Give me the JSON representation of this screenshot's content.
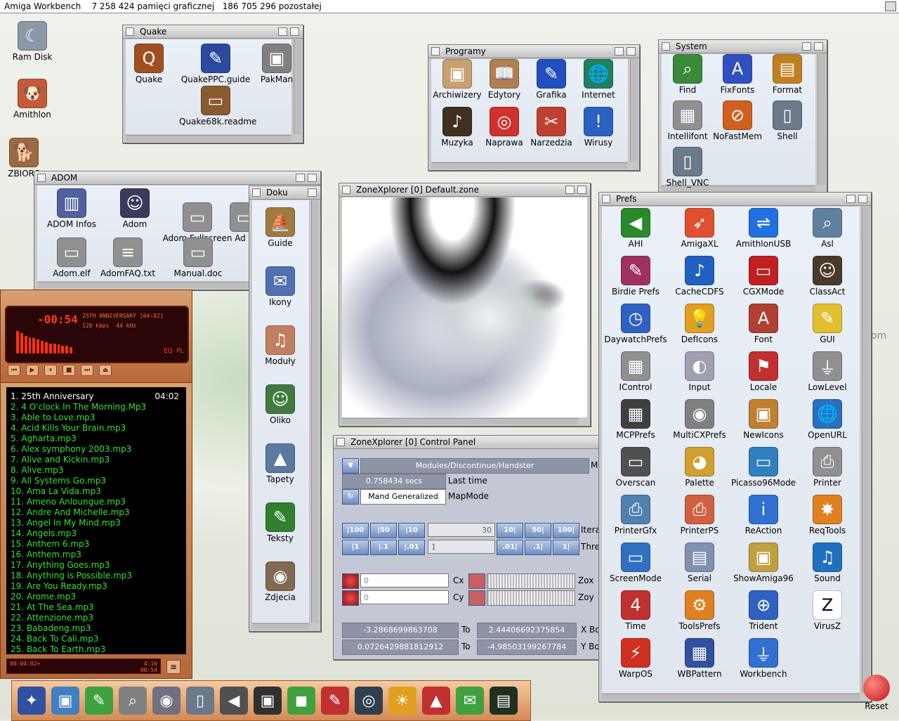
{
  "screen_title": {
    "title": "Amiga Workbench",
    "graphics_memory": "7 258 424 pamięci graficznej",
    "remaining": "186 705 296 pozostałej"
  },
  "desktop_icons": [
    {
      "label": "Ram Disk",
      "icon": "ram-disk-icon",
      "color": "#8a98a8",
      "glyph": "☾"
    },
    {
      "label": "Amithlon",
      "icon": "amithlon-dog-icon",
      "color": "#c35a3a",
      "glyph": "🐶"
    },
    {
      "label": "ZBIORC",
      "icon": "dog-drive-icon",
      "color": "#9a6a40",
      "glyph": "🐕"
    }
  ],
  "windows": {
    "quake": {
      "title": "Quake",
      "icons": [
        {
          "label": "Quake",
          "icon": "quake-icon",
          "color": "#a05020",
          "glyph": "Q"
        },
        {
          "label": "QuakePPC.guide",
          "icon": "guide-icon",
          "color": "#2a4aa0",
          "glyph": "✎"
        },
        {
          "label": "PakMan",
          "icon": "pakman-icon",
          "color": "#808080",
          "glyph": "▣"
        },
        {
          "label": "Quake68k.readme",
          "icon": "readme-icon",
          "color": "#8a5a30",
          "glyph": "▭"
        }
      ]
    },
    "programy": {
      "title": "Programy",
      "icons": [
        {
          "label": "Archiwizery",
          "icon": "archive-box-icon",
          "color": "#c9a070",
          "glyph": "▣"
        },
        {
          "label": "Edytory",
          "icon": "book-icon",
          "color": "#b08050",
          "glyph": "📖"
        },
        {
          "label": "Grafika",
          "icon": "paint-brush-icon",
          "color": "#2050c0",
          "glyph": "✎"
        },
        {
          "label": "Internet",
          "icon": "globe-icon",
          "color": "#208060",
          "glyph": "🌐"
        },
        {
          "label": "Muzyka",
          "icon": "speaker-icon",
          "color": "#403020",
          "glyph": "♪"
        },
        {
          "label": "Naprawa",
          "icon": "lifebuoy-icon",
          "color": "#d03030",
          "glyph": "◎"
        },
        {
          "label": "Narzedzia",
          "icon": "tools-icon",
          "color": "#c04030",
          "glyph": "✂"
        },
        {
          "label": "Wirusy",
          "icon": "folder-warning-icon",
          "color": "#2a60c0",
          "glyph": "!"
        }
      ]
    },
    "system": {
      "title": "System",
      "icons": [
        {
          "label": "Find",
          "icon": "find-icon",
          "color": "#3a8a3a",
          "glyph": "⌕"
        },
        {
          "label": "FixFonts",
          "icon": "fixfonts-icon",
          "color": "#3050c0",
          "glyph": "A"
        },
        {
          "label": "Format",
          "icon": "format-disk-icon",
          "color": "#c08020",
          "glyph": "▤"
        },
        {
          "label": "Intellifont",
          "icon": "intellifont-icon",
          "color": "#909090",
          "glyph": "▦"
        },
        {
          "label": "NoFastMem",
          "icon": "nofastmem-icon",
          "color": "#d06020",
          "glyph": "⊘"
        },
        {
          "label": "Shell",
          "icon": "shell-icon",
          "color": "#6a7a8a",
          "glyph": "▯"
        },
        {
          "label": "Shell_VNC",
          "icon": "shell-vnc-icon",
          "color": "#6a7a8a",
          "glyph": "▯"
        }
      ]
    },
    "adom": {
      "title": "ADOM",
      "icons": [
        {
          "label": "ADOM Infos",
          "icon": "adom-infos-icon",
          "color": "#5060a0",
          "glyph": "▥"
        },
        {
          "label": "Adom",
          "icon": "adom-face-icon",
          "color": "#3a3a5a",
          "glyph": "☺"
        },
        {
          "label": "Adom Fullscreen",
          "icon": "fullscreen-icon",
          "color": "#909090",
          "glyph": "▭"
        },
        {
          "label": "Ad",
          "icon": "partial-icon",
          "color": "#909090",
          "glyph": "▭"
        },
        {
          "label": "Adom.elf",
          "icon": "elf-file-icon",
          "color": "#909090",
          "glyph": "▭"
        },
        {
          "label": "AdomFAQ.txt",
          "icon": "text-file-icon",
          "color": "#909090",
          "glyph": "≡"
        },
        {
          "label": "Manual.doc",
          "icon": "doc-file-icon",
          "color": "#909090",
          "glyph": "▭"
        }
      ]
    },
    "doku": {
      "title": "Doku",
      "icons": [
        {
          "label": "Guide",
          "icon": "ship-icon",
          "color": "#a07a40",
          "glyph": "⛵"
        },
        {
          "label": "Ikony",
          "icon": "stamp-icon",
          "color": "#5070b0",
          "glyph": "✉"
        },
        {
          "label": "Moduły",
          "icon": "bear-music-icon",
          "color": "#c08060",
          "glyph": "♫"
        },
        {
          "label": "Oliko",
          "icon": "portrait-icon",
          "color": "#407a40",
          "glyph": "☺"
        },
        {
          "label": "Tapety",
          "icon": "mountain-icon",
          "color": "#5a7aa0",
          "glyph": "▲"
        },
        {
          "label": "Teksty",
          "icon": "pen-icon",
          "color": "#308030",
          "glyph": "✎"
        },
        {
          "label": "Zdjecia",
          "icon": "photo-icon",
          "color": "#806a50",
          "glyph": "◉"
        }
      ]
    },
    "zone_view": {
      "title": "ZoneXplorer [0] Default.zone"
    },
    "control_panel": {
      "title": "ZoneXplorer [0] Control Panel",
      "module": "Modules/Discontinue/Handster",
      "module_suffix": "M",
      "last_time_value": "0.758434 secs",
      "last_time_label": "Last time",
      "mapmode_value": "Mand Generalized",
      "mapmode_label": "MapMode",
      "iter_buttons_left": [
        "|100",
        "|50",
        "|10"
      ],
      "iter_buttons_right": [
        "10|",
        "50|",
        "100|"
      ],
      "iter_value": "30",
      "iter_label": "Itera",
      "thre_buttons_left": [
        "|1",
        "|.1",
        "|.01"
      ],
      "thre_buttons_right": [
        ".01|",
        ".1|",
        "1|"
      ],
      "thre_value": "1",
      "thre_label": "Thre",
      "cx_value": "0",
      "cx_label": "Cx",
      "zox_label": "Zox",
      "cy_value": "0",
      "cy_label": "Cy",
      "zoy_label": "Zoy",
      "xb_from": "-3.2868699863708",
      "xb_to": "2.44406692375854",
      "to_label": "To",
      "xb_label": "X Bo",
      "yb_from": "0.0726429881812912",
      "yb_to": "-4.98503199267784",
      "yb_label": "Y Bo"
    },
    "prefs": {
      "title": "Prefs",
      "icons": [
        {
          "label": "AHI",
          "icon": "speaker-ahi-icon",
          "color": "#2a8a2a",
          "glyph": "◀"
        },
        {
          "label": "AmigaXL",
          "icon": "rocket-icon",
          "color": "#e05030",
          "glyph": "➶"
        },
        {
          "label": "AmithlonUSB",
          "icon": "usb-icon",
          "color": "#2070e0",
          "glyph": "⇌"
        },
        {
          "label": "Asl",
          "icon": "magnifier-icon",
          "color": "#6080a0",
          "glyph": "⌕"
        },
        {
          "label": "Birdie Prefs",
          "icon": "brush-icon",
          "color": "#a03060",
          "glyph": "✎"
        },
        {
          "label": "CacheCDFS",
          "icon": "cd-music-icon",
          "color": "#2060c0",
          "glyph": "♪"
        },
        {
          "label": "CGXMode",
          "icon": "monitor-icon",
          "color": "#c02020",
          "glyph": "▭"
        },
        {
          "label": "ClassAct",
          "icon": "face-icon",
          "color": "#4a3a2a",
          "glyph": "☺"
        },
        {
          "label": "DaywatchPrefs",
          "icon": "clock-icon",
          "color": "#3060c0",
          "glyph": "◷"
        },
        {
          "label": "DefIcons",
          "icon": "lightbulb-icon",
          "color": "#e0a020",
          "glyph": "💡"
        },
        {
          "label": "Font",
          "icon": "font-icon",
          "color": "#b04030",
          "glyph": "A"
        },
        {
          "label": "GUI",
          "icon": "gui-brush-icon",
          "color": "#e0c030",
          "glyph": "✎"
        },
        {
          "label": "IControl",
          "icon": "cubes-icon",
          "color": "#909090",
          "glyph": "▦"
        },
        {
          "label": "Input",
          "icon": "mouse-icon",
          "color": "#a0a0b0",
          "glyph": "◐"
        },
        {
          "label": "Locale",
          "icon": "flags-icon",
          "color": "#c03030",
          "glyph": "⚑"
        },
        {
          "label": "LowLevel",
          "icon": "joystick-icon",
          "color": "#909090",
          "glyph": "⏚"
        },
        {
          "label": "MCPPrefs",
          "icon": "chip-icon",
          "color": "#404040",
          "glyph": "▦"
        },
        {
          "label": "MultiCXPrefs",
          "icon": "camera-icon",
          "color": "#808080",
          "glyph": "◉"
        },
        {
          "label": "NewIcons",
          "icon": "newicons-icon",
          "color": "#c08030",
          "glyph": "▣"
        },
        {
          "label": "OpenURL",
          "icon": "openurl-globe-icon",
          "color": "#2a70c0",
          "glyph": "🌐"
        },
        {
          "label": "Overscan",
          "icon": "overscan-monitor-icon",
          "color": "#505050",
          "glyph": "▭"
        },
        {
          "label": "Palette",
          "icon": "palette-icon",
          "color": "#d0a030",
          "glyph": "◕"
        },
        {
          "label": "Picasso96Mode",
          "icon": "picasso-monitor-icon",
          "color": "#3080c0",
          "glyph": "▭"
        },
        {
          "label": "Printer",
          "icon": "printer-icon",
          "color": "#909090",
          "glyph": "⎙"
        },
        {
          "label": "PrinterGfx",
          "icon": "printer-gfx-icon",
          "color": "#5080b0",
          "glyph": "⎙"
        },
        {
          "label": "PrinterPS",
          "icon": "printer-ps-icon",
          "color": "#d06040",
          "glyph": "⎙"
        },
        {
          "label": "ReAction",
          "icon": "reaction-info-icon",
          "color": "#3070d0",
          "glyph": "i"
        },
        {
          "label": "ReqTools",
          "icon": "reqtools-star-icon",
          "color": "#e08020",
          "glyph": "✸"
        },
        {
          "label": "ScreenMode",
          "icon": "screenmode-monitor-icon",
          "color": "#3070c0",
          "glyph": "▭"
        },
        {
          "label": "Serial",
          "icon": "serial-icon",
          "color": "#8090b0",
          "glyph": "▤"
        },
        {
          "label": "ShowAmiga96",
          "icon": "showamiga-icon",
          "color": "#c0a040",
          "glyph": "▣"
        },
        {
          "label": "Sound",
          "icon": "music-note-icon",
          "color": "#2070c0",
          "glyph": "♫"
        },
        {
          "label": "Time",
          "icon": "calendar-icon",
          "color": "#c03030",
          "glyph": "4"
        },
        {
          "label": "ToolsPrefs",
          "icon": "gear-icon",
          "color": "#e08020",
          "glyph": "⚙"
        },
        {
          "label": "Trident",
          "icon": "trident-icon",
          "color": "#3060c0",
          "glyph": "⊕"
        },
        {
          "label": "VirusZ",
          "icon": "virusz-icon",
          "color": "#ffffff",
          "glyph": "Z"
        },
        {
          "label": "WarpOS",
          "icon": "warpos-icon",
          "color": "#d03020",
          "glyph": "⚡"
        },
        {
          "label": "WBPattern",
          "icon": "wbpattern-icon",
          "color": "#3050a0",
          "glyph": "▦"
        },
        {
          "label": "Workbench",
          "icon": "workbench-joystick-icon",
          "color": "#3070d0",
          "glyph": "⏚"
        }
      ]
    }
  },
  "player": {
    "time": "-00:54",
    "track": "25TH ANNIVERSARY [04:02]",
    "bitrate": "128 kbps",
    "freq": "44 kHz",
    "eq": "EQ",
    "pl": "PL",
    "bar_levels": [
      0.9,
      0.8,
      0.7,
      0.65,
      0.6,
      0.55,
      0.5,
      0.45,
      0.4,
      0.4,
      0.35,
      0.3,
      0.3,
      0.25
    ]
  },
  "playlist": {
    "items": [
      {
        "label": "1. 25th Anniversary",
        "dur": "04:02"
      },
      {
        "label": "2. 4 O'clock In The Morning.Mp3"
      },
      {
        "label": "3. Able to Love.mp3"
      },
      {
        "label": "4. Acid Kills Your Brain.mp3"
      },
      {
        "label": "5. Agharta.mp3"
      },
      {
        "label": "6. Alex symphony 2003.mp3"
      },
      {
        "label": "7. Alive and Kickin.mp3"
      },
      {
        "label": "8. Alive.mp3"
      },
      {
        "label": "9. All Systems Go.mp3"
      },
      {
        "label": "10. Ama La Vida.mp3"
      },
      {
        "label": "11. Ameno Anloungue.mp3"
      },
      {
        "label": "12. Andre And Michelle.mp3"
      },
      {
        "label": "13. Angel In My Mind.mp3"
      },
      {
        "label": "14. Angels.mp3"
      },
      {
        "label": "15. Anthem 6.mp3"
      },
      {
        "label": "16. Anthem.mp3"
      },
      {
        "label": "17. Anything Goes.mp3"
      },
      {
        "label": "18. Anything is Possible.mp3"
      },
      {
        "label": "19. Are You Ready.mp3"
      },
      {
        "label": "20. Arome.mp3"
      },
      {
        "label": "21. At The Sea.mp3"
      },
      {
        "label": "22. Attenzione.mp3"
      },
      {
        "label": "23. Babadeng.mp3"
      },
      {
        "label": "24. Back To Cali.mp3"
      },
      {
        "label": "25. Back To Earth.mp3"
      }
    ],
    "footer_time": "00:04:02+",
    "footer_total": "4:16",
    "footer_pos": "00:54"
  },
  "taskbar": [
    {
      "icon": "rocket-dock-icon",
      "color": "#3050a0",
      "glyph": "✦"
    },
    {
      "icon": "windows-icon",
      "color": "#4080c0",
      "glyph": "▣"
    },
    {
      "icon": "notes-icon",
      "color": "#40a040",
      "glyph": "✎"
    },
    {
      "icon": "search-icon",
      "color": "#808080",
      "glyph": "⌕"
    },
    {
      "icon": "eye-icon",
      "color": "#707080",
      "glyph": "◉"
    },
    {
      "icon": "shell-task-icon",
      "color": "#6a7a8a",
      "glyph": "▯"
    },
    {
      "icon": "speaker-task-icon",
      "color": "#505050",
      "glyph": "◀"
    },
    {
      "icon": "floppy-icon",
      "color": "#303030",
      "glyph": "▣"
    },
    {
      "icon": "cube-icon",
      "color": "#40a040",
      "glyph": "◼"
    },
    {
      "icon": "paint-task-icon",
      "color": "#c03030",
      "glyph": "✎"
    },
    {
      "icon": "globe-task-icon",
      "color": "#304050",
      "glyph": "◎"
    },
    {
      "icon": "sun-icon",
      "color": "#e0a020",
      "glyph": "☀"
    },
    {
      "icon": "chart-icon",
      "color": "#c03030",
      "glyph": "▲"
    },
    {
      "icon": "mail-icon",
      "color": "#40a040",
      "glyph": "✉"
    },
    {
      "icon": "terminal-icon",
      "color": "#203020",
      "glyph": "▤"
    }
  ],
  "reset_label": "Reset",
  "desktop_bg_text": "om"
}
